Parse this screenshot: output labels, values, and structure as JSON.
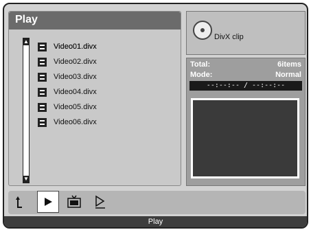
{
  "panel": {
    "title": "Play",
    "files": [
      {
        "label": "Video01.divx"
      },
      {
        "label": "Video02.divx"
      },
      {
        "label": "Video03.divx"
      },
      {
        "label": "Video04.divx"
      },
      {
        "label": "Video05.divx"
      },
      {
        "label": "Video06.divx"
      }
    ]
  },
  "info": {
    "clip_label": "DivX clip",
    "total_label": "Total:",
    "total_value": "6items",
    "mode_label": "Mode:",
    "mode_value": "Normal",
    "time": "--:--:-- / --:--:--"
  },
  "toolbar": {
    "icons": [
      "return-icon",
      "play-icon",
      "tv-icon",
      "eject-icon"
    ]
  },
  "status": {
    "text": "Play"
  }
}
